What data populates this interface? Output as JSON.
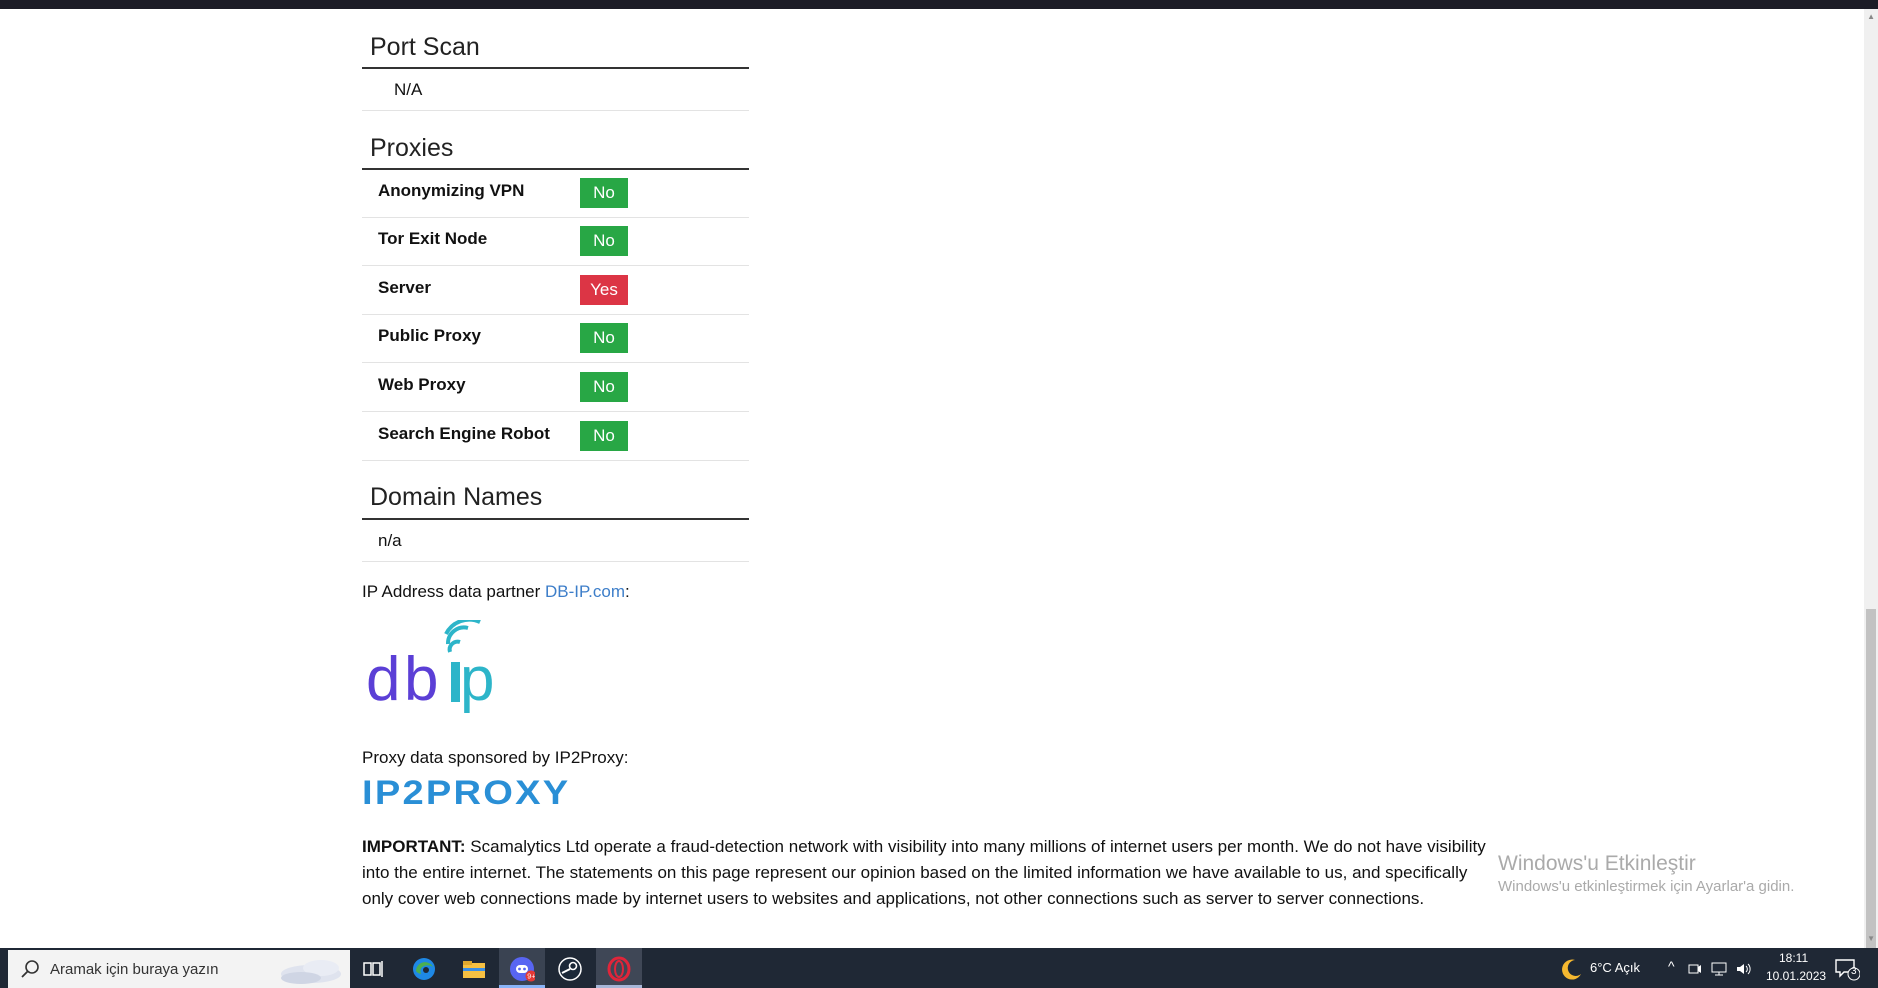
{
  "sections": {
    "port_scan": {
      "title": "Port Scan",
      "value": "N/A"
    },
    "proxies": {
      "title": "Proxies",
      "rows": [
        {
          "label": "Anonymizing VPN",
          "value": "No",
          "status_color": "#28a745"
        },
        {
          "label": "Tor Exit Node",
          "value": "No",
          "status_color": "#28a745"
        },
        {
          "label": "Server",
          "value": "Yes",
          "status_color": "#dc3545"
        },
        {
          "label": "Public Proxy",
          "value": "No",
          "status_color": "#28a745"
        },
        {
          "label": "Web Proxy",
          "value": "No",
          "status_color": "#28a745"
        },
        {
          "label": "Search Engine Robot",
          "value": "No",
          "status_color": "#28a745"
        }
      ]
    },
    "domain_names": {
      "title": "Domain Names",
      "value": "n/a"
    }
  },
  "partners": {
    "dbip_prefix": "IP Address data partner ",
    "dbip_link": "DB-IP.com",
    "dbip_suffix": ":",
    "dbip_logo": "dbip",
    "ip2proxy_text": "Proxy data sponsored by IP2Proxy:",
    "ip2proxy_logo": "IP2PROXY"
  },
  "important": {
    "label": "IMPORTANT:",
    "text": " Scamalytics Ltd operate a fraud-detection network with visibility into many millions of internet users per month. We do not have visibility into the entire internet. The statements on this page represent our opinion based on the limited information we have available to us, and specifically only cover web connections made by internet users to websites and applications, not other connections such as server to server connections."
  },
  "watermark": {
    "title": "Windows'u Etkinleştir",
    "subtitle": "Windows'u etkinleştirmek için Ayarlar'a gidin."
  },
  "taskbar": {
    "search_placeholder": "Aramak için buraya yazın",
    "apps": [
      "task-view-icon",
      "edge-icon",
      "file-explorer-icon",
      "discord-icon",
      "steam-icon",
      "opera-icon"
    ],
    "weather": "6°C  Açık",
    "time": "18:11",
    "date": "10.01.2023",
    "notifications": "3"
  },
  "colors": {
    "accent_link": "#3d7ec9",
    "no": "#28a745",
    "yes": "#dc3545"
  }
}
